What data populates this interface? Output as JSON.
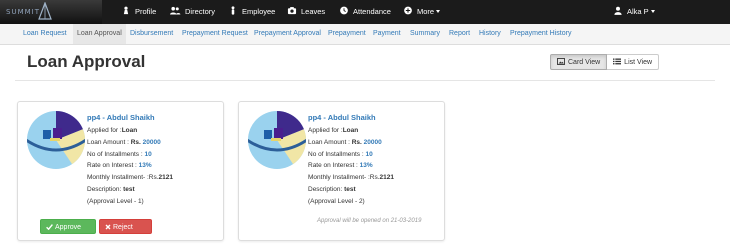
{
  "topnav": {
    "logo_text": "SUMMIT",
    "items": [
      {
        "label": "Profile",
        "icon": "chess-pawn-icon"
      },
      {
        "label": "Directory",
        "icon": "users-icon"
      },
      {
        "label": "Employee",
        "icon": "user-icon"
      },
      {
        "label": "Leaves",
        "icon": "camera-icon"
      },
      {
        "label": "Attendance",
        "icon": "clock-icon"
      },
      {
        "label": "More",
        "icon": "plus-circle-icon"
      }
    ],
    "user": {
      "label": "Alka P",
      "icon": "user-icon"
    }
  },
  "subnav": {
    "items": [
      {
        "label": "Loan Request"
      },
      {
        "label": "Loan Approval",
        "active": true
      },
      {
        "label": "Disbursement"
      },
      {
        "label": "Prepayment Request"
      },
      {
        "label": "Prepayment Approval"
      },
      {
        "label": "Prepayment"
      },
      {
        "label": "Payment"
      },
      {
        "label": "Summary"
      },
      {
        "label": "Report"
      },
      {
        "label": "History"
      },
      {
        "label": "Prepayment History"
      }
    ]
  },
  "page": {
    "title": "Loan Approval",
    "card_view_label": "Card View",
    "list_view_label": "List View"
  },
  "cards": [
    {
      "title": "pp4 - Abdul Shaikh",
      "applied_label": "Applied for :",
      "applied_value": "Loan",
      "amount_label": "Loan Amount : ",
      "amount_currency": "Rs.",
      "amount_value": "20000",
      "installments_label": "No of Installments : ",
      "installments_value": "10",
      "rate_label": "Rate on Interest : ",
      "rate_value": "13%",
      "monthly_label": "Monthly Installment- :Rs.",
      "monthly_value": "2121",
      "desc_label": "Description: ",
      "desc_value": "test",
      "level": "(Approval Level - 1)",
      "approve_label": "Approve",
      "reject_label": "Reject"
    },
    {
      "title": "pp4 - Abdul Shaikh",
      "applied_label": "Applied for :",
      "applied_value": "Loan",
      "amount_label": "Loan Amount : ",
      "amount_currency": "Rs.",
      "amount_value": "20000",
      "installments_label": "No of Installments : ",
      "installments_value": "10",
      "rate_label": "Rate on Interest : ",
      "rate_value": "13%",
      "monthly_label": "Monthly Installment- :Rs.",
      "monthly_value": "2121",
      "desc_label": "Description: ",
      "desc_value": "test",
      "level": "(Approval Level - 2)",
      "note": "Approval will be opened on 21-03-2019"
    }
  ],
  "colors": {
    "link": "#337ab7",
    "approve": "#5cb85c",
    "reject": "#d9534f",
    "navbar": "#1b1b1b"
  }
}
